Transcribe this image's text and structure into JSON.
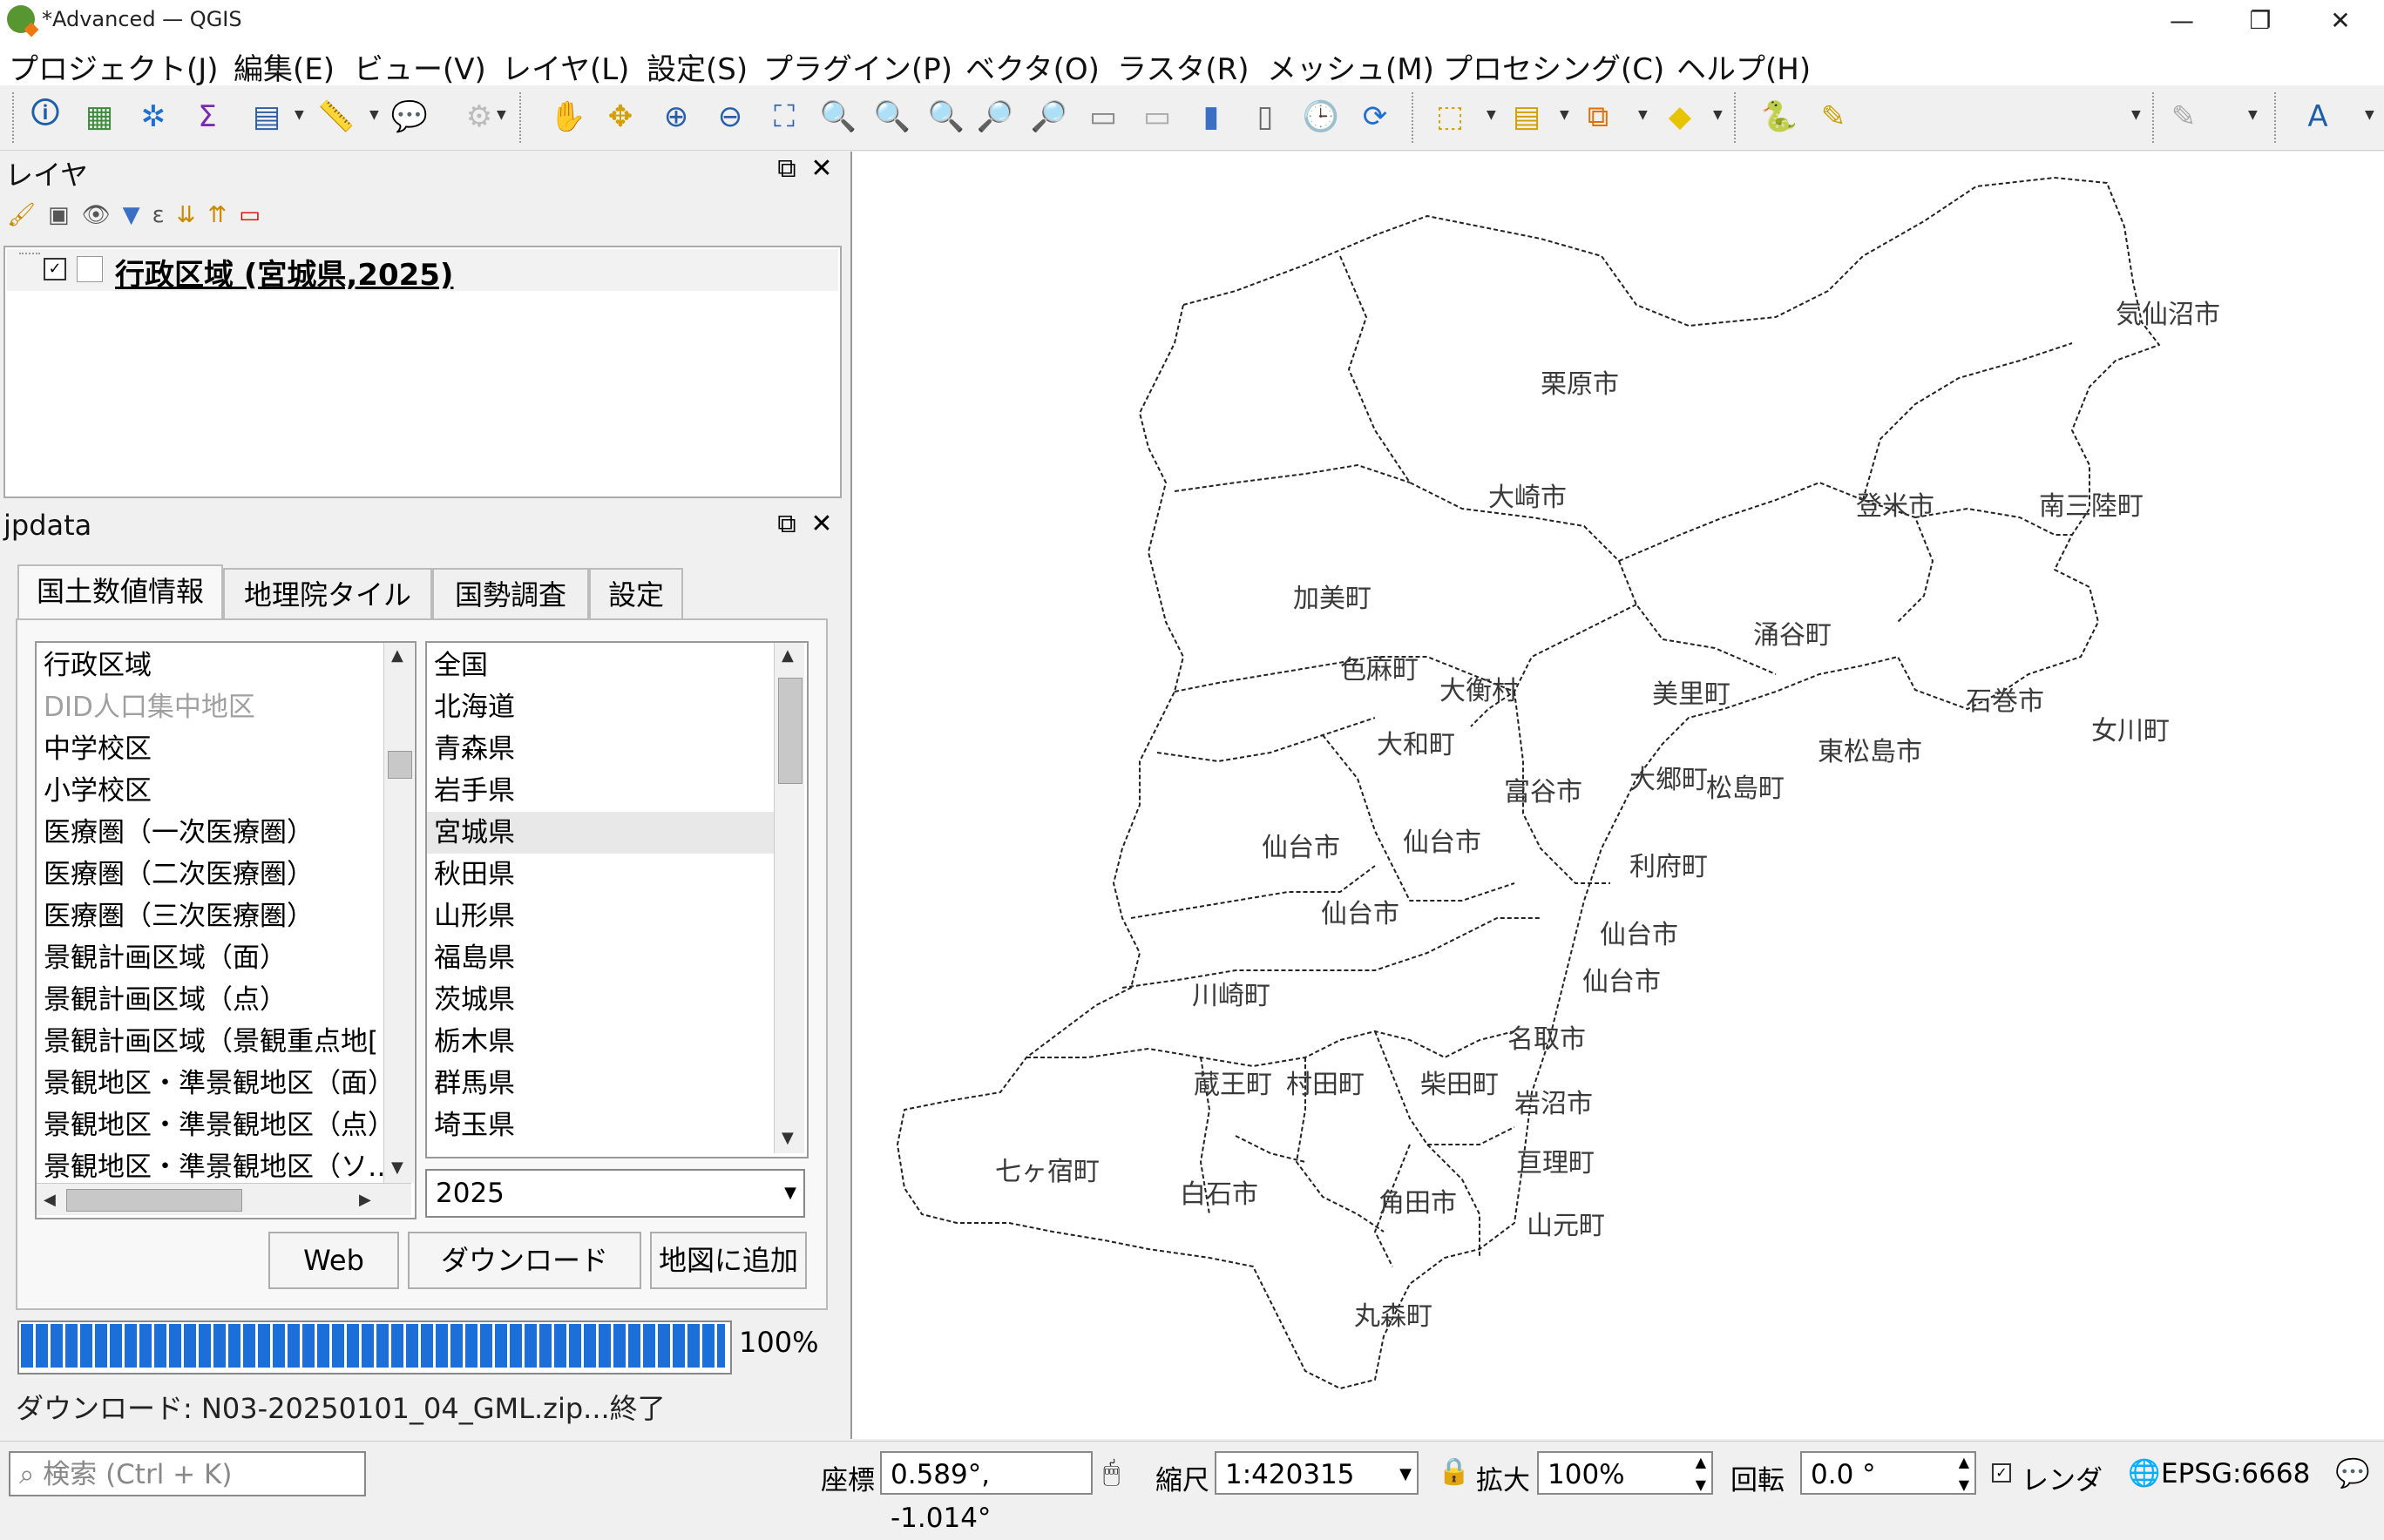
{
  "window": {
    "title": "*Advanced — QGIS",
    "minimize": "—",
    "maximize": "❐",
    "close": "✕"
  },
  "menu": [
    "プロジェクト(J)",
    "編集(E)",
    "ビュー(V)",
    "レイヤ(L)",
    "設定(S)",
    "プラグイン(P)",
    "ベクタ(O)",
    "ラスタ(R)",
    "メッシュ(M)",
    "プロセシング(C)",
    "ヘルプ(H)"
  ],
  "toolbar_icons": [
    {
      "name": "identify-icon",
      "glyph": "🛈",
      "color": "#1f5fa8"
    },
    {
      "name": "attribute-table-icon",
      "glyph": "▦",
      "color": "#3a8a3a"
    },
    {
      "name": "settings-gear-icon",
      "glyph": "✲",
      "color": "#1f6fcf"
    },
    {
      "name": "statistics-sigma-icon",
      "glyph": "Σ",
      "color": "#7a2bb0"
    },
    {
      "name": "open-table-icon",
      "glyph": "▤",
      "color": "#2a5fa8"
    },
    {
      "name": "measure-icon",
      "glyph": "📏",
      "color": "#555"
    },
    {
      "name": "map-tips-icon",
      "glyph": "💬",
      "color": "#e8c400"
    },
    {
      "name": "zoom-disabled-icon",
      "glyph": "⚙",
      "color": "#bbb"
    },
    {
      "name": "pan-hand-icon",
      "glyph": "✋",
      "color": "#333"
    },
    {
      "name": "pan-to-selection-icon",
      "glyph": "✥",
      "color": "#d4a000"
    },
    {
      "name": "zoom-in-icon",
      "glyph": "⊕",
      "color": "#2a5fa8"
    },
    {
      "name": "zoom-out-icon",
      "glyph": "⊖",
      "color": "#2a5fa8"
    },
    {
      "name": "zoom-full-icon",
      "glyph": "⛶",
      "color": "#2a5fa8"
    },
    {
      "name": "zoom-to-selection-icon",
      "glyph": "🔍",
      "color": "#c9a000"
    },
    {
      "name": "zoom-to-layer-icon",
      "glyph": "🔍",
      "color": "#777"
    },
    {
      "name": "zoom-native-icon",
      "glyph": "🔍",
      "color": "#aaa"
    },
    {
      "name": "zoom-last-icon",
      "glyph": "🔎",
      "color": "#2a5fa8"
    },
    {
      "name": "zoom-next-icon",
      "glyph": "🔎",
      "color": "#bbb"
    },
    {
      "name": "new-bookmark-icon",
      "glyph": "▭",
      "color": "#888"
    },
    {
      "name": "show-bookmarks-icon",
      "glyph": "▭",
      "color": "#aaa"
    },
    {
      "name": "new-map-view-icon",
      "glyph": "▮",
      "color": "#3a6fc4"
    },
    {
      "name": "map-3d-icon",
      "glyph": "▯",
      "color": "#666"
    },
    {
      "name": "temporal-clock-icon",
      "glyph": "🕒",
      "color": "#555"
    },
    {
      "name": "refresh-icon",
      "glyph": "⟳",
      "color": "#1f6fcf"
    },
    {
      "name": "select-features-icon",
      "glyph": "⬚",
      "color": "#d4a000"
    },
    {
      "name": "select-by-value-icon",
      "glyph": "▤",
      "color": "#d4a000"
    },
    {
      "name": "deselect-icon",
      "glyph": "⧉",
      "color": "#e07000"
    },
    {
      "name": "edit-selection-icon",
      "glyph": "◆",
      "color": "#e8c400"
    },
    {
      "name": "python-icon",
      "glyph": "🐍",
      "color": "#3a6fc4"
    },
    {
      "name": "digitize-pencil-icon",
      "glyph": "✎",
      "color": "#c9a000"
    },
    {
      "name": "advanced-digitize-icon",
      "glyph": "✎",
      "color": "#aaa"
    },
    {
      "name": "label-tool-icon",
      "glyph": "A",
      "color": "#1f5fa8"
    }
  ],
  "layers_panel": {
    "title": "レイヤ",
    "layer_name": "行政区域 (宮城県,2025)",
    "checked": "✓"
  },
  "jpdata_panel": {
    "title": "jpdata",
    "tabs": [
      "国土数値情報",
      "地理院タイル",
      "国勢調査",
      "設定"
    ],
    "datasets": [
      {
        "label": "行政区域",
        "disabled": false
      },
      {
        "label": "DID人口集中地区",
        "disabled": true
      },
      {
        "label": "中学校区",
        "disabled": false
      },
      {
        "label": "小学校区",
        "disabled": false
      },
      {
        "label": "医療圏（一次医療圏）",
        "disabled": false
      },
      {
        "label": "医療圏（二次医療圏）",
        "disabled": false
      },
      {
        "label": "医療圏（三次医療圏）",
        "disabled": false
      },
      {
        "label": "景観計画区域（面）",
        "disabled": false
      },
      {
        "label": "景観計画区域（点）",
        "disabled": false
      },
      {
        "label": "景観計画区域（景観重点地[",
        "disabled": false
      },
      {
        "label": "景観地区・準景観地区（面）",
        "disabled": false
      },
      {
        "label": "景観地区・準景観地区（点）",
        "disabled": false
      },
      {
        "label": "景観地区・準景観地区（ソ…",
        "disabled": false
      }
    ],
    "prefectures": [
      "全国",
      "北海道",
      "青森県",
      "岩手県",
      "宮城県",
      "秋田県",
      "山形県",
      "福島県",
      "茨城県",
      "栃木県",
      "群馬県",
      "埼玉県"
    ],
    "selected_prefecture": "宮城県",
    "year": "2025",
    "buttons": {
      "web": "Web",
      "download": "ダウンロード",
      "add_to_map": "地図に追加"
    },
    "progress_value": 1.0,
    "progress_text": "100%",
    "status_message": "ダウンロード: N03-20250101_04_GML.zip...終了"
  },
  "map_labels": [
    "気仙沼市",
    "栗原市",
    "大崎市",
    "登米市",
    "南三陸町",
    "加美町",
    "涌谷町",
    "色麻町",
    "大衡村",
    "美里町",
    "石巻市",
    "女川町",
    "大和町",
    "東松島市",
    "大郷町",
    "松島町",
    "富谷市",
    "仙台市",
    "仙台市",
    "利府町",
    "仙台市",
    "仙台市",
    "仙台市",
    "川崎町",
    "名取市",
    "蔵王町",
    "村田町",
    "柴田町",
    "岩沼市",
    "七ヶ宿町",
    "亘理町",
    "白石市",
    "角田市",
    "山元町",
    "丸森町"
  ],
  "statusbar": {
    "search_placeholder": "検索 (Ctrl + K)",
    "coord_label": "座標",
    "coord_value": "0.589°, -1.014°",
    "scale_label": "縮尺",
    "scale_value": "1:420315",
    "magnifier_label": "拡大",
    "magnifier_value": "100%",
    "rotation_label": "回転",
    "rotation_value": "0.0 °",
    "render_label": "レンダ",
    "crs": "EPSG:6668"
  }
}
